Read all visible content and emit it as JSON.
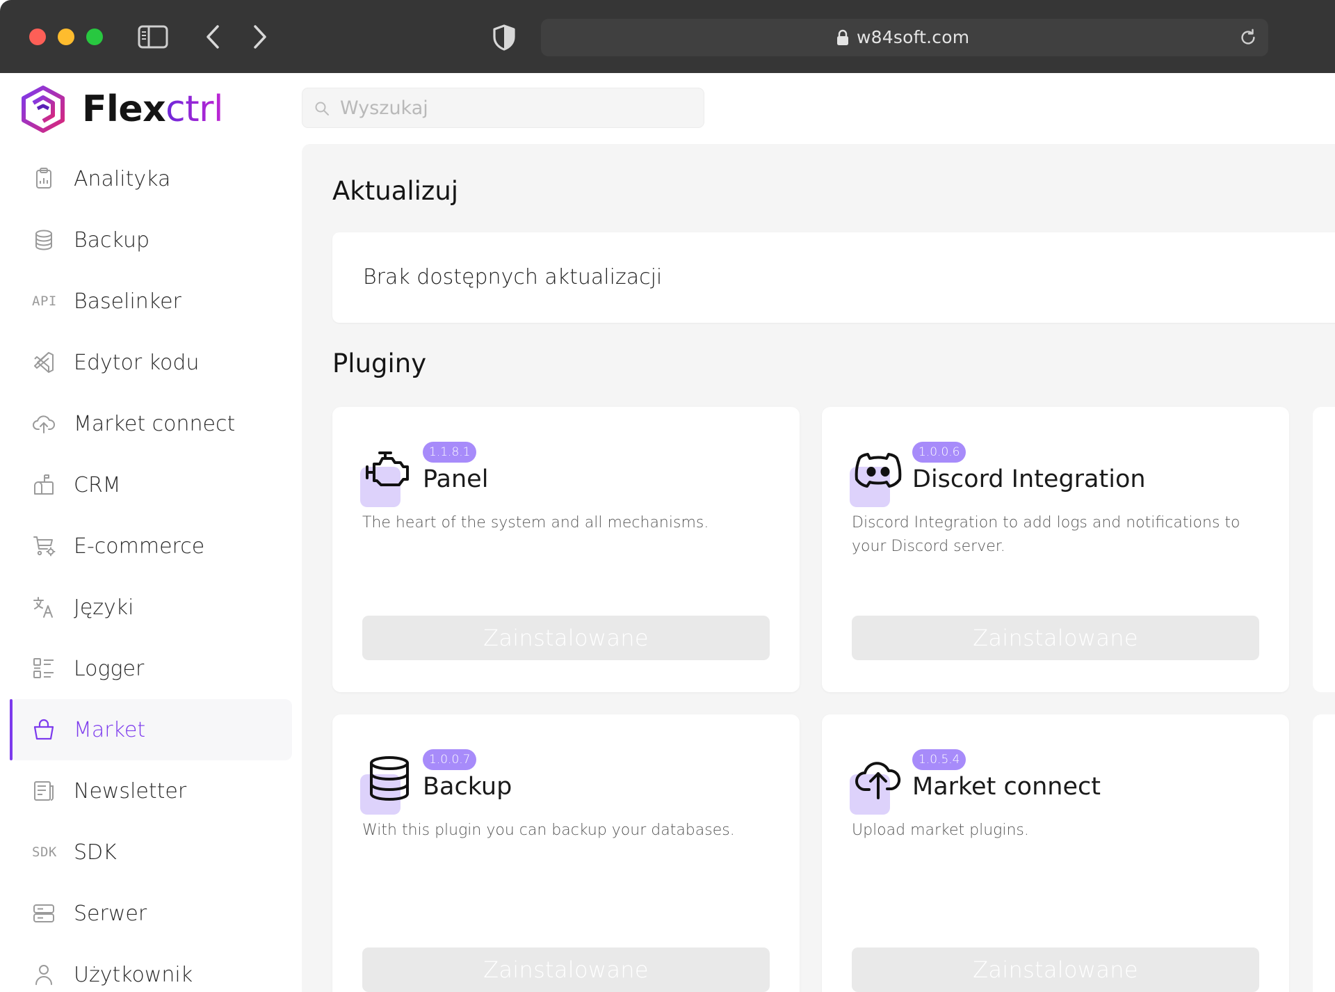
{
  "browser": {
    "url": "w84soft.com"
  },
  "logo": {
    "part1": "Flex",
    "part2": "ctrl"
  },
  "search": {
    "placeholder": "Wyszukaj"
  },
  "sidebar": {
    "items": [
      {
        "label": "Analityka",
        "icon": "clipboard-chart-icon"
      },
      {
        "label": "Backup",
        "icon": "database-icon"
      },
      {
        "label": "Baselinker",
        "icon": "api-icon",
        "icon_text": "API"
      },
      {
        "label": "Edytor kodu",
        "icon": "code-editor-icon"
      },
      {
        "label": "Market connect",
        "icon": "cloud-upload-icon"
      },
      {
        "label": "CRM",
        "icon": "mailbox-icon"
      },
      {
        "label": "E-commerce",
        "icon": "cart-settings-icon"
      },
      {
        "label": "Języki",
        "icon": "translate-icon"
      },
      {
        "label": "Logger",
        "icon": "list-icon"
      },
      {
        "label": "Market",
        "icon": "shopping-bag-icon",
        "active": true
      },
      {
        "label": "Newsletter",
        "icon": "newspaper-icon"
      },
      {
        "label": "SDK",
        "icon": "sdk-icon",
        "icon_text": "SDK"
      },
      {
        "label": "Serwer",
        "icon": "server-icon"
      },
      {
        "label": "Użytkownik",
        "icon": "user-icon"
      }
    ]
  },
  "main": {
    "update_title": "Aktualizuj",
    "update_message": "Brak dostępnych aktualizacji",
    "plugins_title": "Pluginy",
    "plugins": [
      {
        "name": "Panel",
        "version": "1.1.8.1",
        "description": "The heart of the system and all mechanisms.",
        "button": "Zainstalowane",
        "icon": "engine-icon"
      },
      {
        "name": "Discord Integration",
        "version": "1.0.0.6",
        "description": "Discord Integration to add logs and notifications to your Discord server.",
        "button": "Zainstalowane",
        "icon": "discord-icon"
      },
      {
        "name": "Backup",
        "version": "1.0.0.7",
        "description": "With this plugin you can backup your databases.",
        "button": "Zainstalowane",
        "icon": "database-icon"
      },
      {
        "name": "Market connect",
        "version": "1.0.5.4",
        "description": "Upload market plugins.",
        "button": "Zainstalowane",
        "icon": "cloud-upload-icon"
      }
    ]
  },
  "colors": {
    "accent": "#7c3aed",
    "version_badge": "#a78bfa",
    "icon_bg": "#ddd2fb",
    "titlebar": "#363636"
  }
}
